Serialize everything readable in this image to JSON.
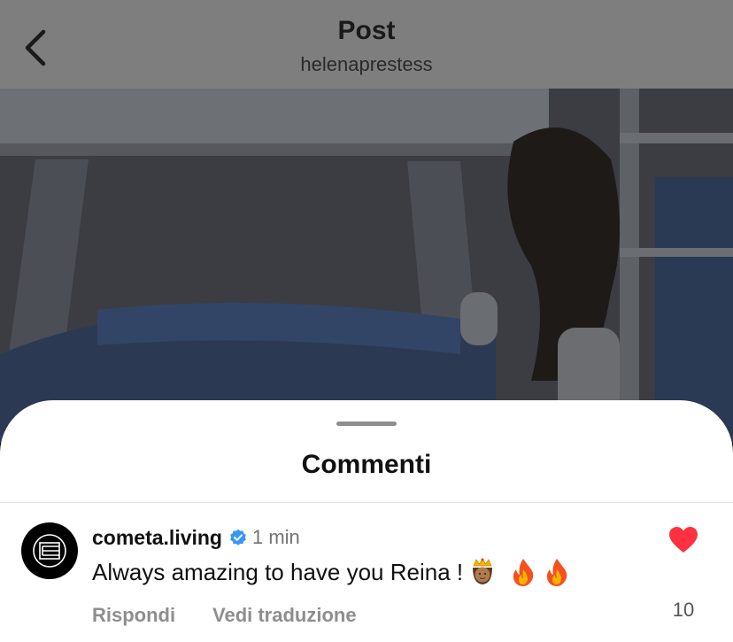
{
  "header": {
    "title": "Post",
    "subtitle": "helenaprestess"
  },
  "sheet": {
    "title": "Commenti"
  },
  "comment": {
    "username": "cometa.living",
    "verified": true,
    "time": "1 min",
    "text": "Always amazing to have you Reina !",
    "emojis": [
      "queen-emoji",
      "fire-emoji",
      "fire-emoji"
    ],
    "reply_label": "Rispondi",
    "translate_label": "Vedi traduzione",
    "like_count": "10",
    "liked": true
  },
  "colors": {
    "like_red": "#ff3040",
    "verified_blue": "#3897f0",
    "secondary_text": "#8e8e8e"
  }
}
